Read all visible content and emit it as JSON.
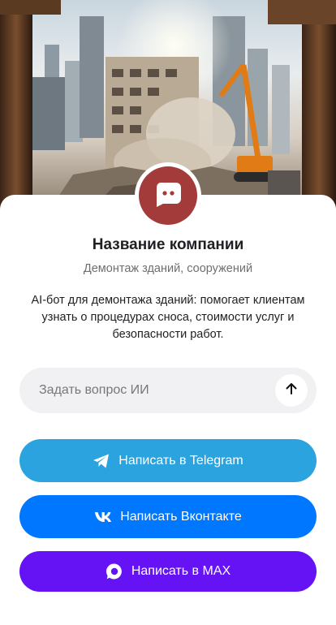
{
  "company": {
    "name": "Название компании",
    "subtitle": "Демонтаж зданий, сооружений",
    "description": "AI-бот для демонтажа зданий: помогает клиентам узнать о процедурах сноса, стоимости услуг и безопасности работ.",
    "avatar_icon": "chat-bubble-icon",
    "avatar_color": "#a33b3b"
  },
  "ask": {
    "placeholder": "Задать вопрос ИИ",
    "value": "",
    "send_icon": "arrow-up-icon"
  },
  "buttons": [
    {
      "label": "Написать в Telegram",
      "icon": "telegram-icon",
      "color": "#2aa3df"
    },
    {
      "label": "Написать Вконтакте",
      "icon": "vk-icon",
      "color": "#0077ff"
    },
    {
      "label": "Написать в MAX",
      "icon": "max-icon",
      "color": "#6512f5"
    }
  ]
}
